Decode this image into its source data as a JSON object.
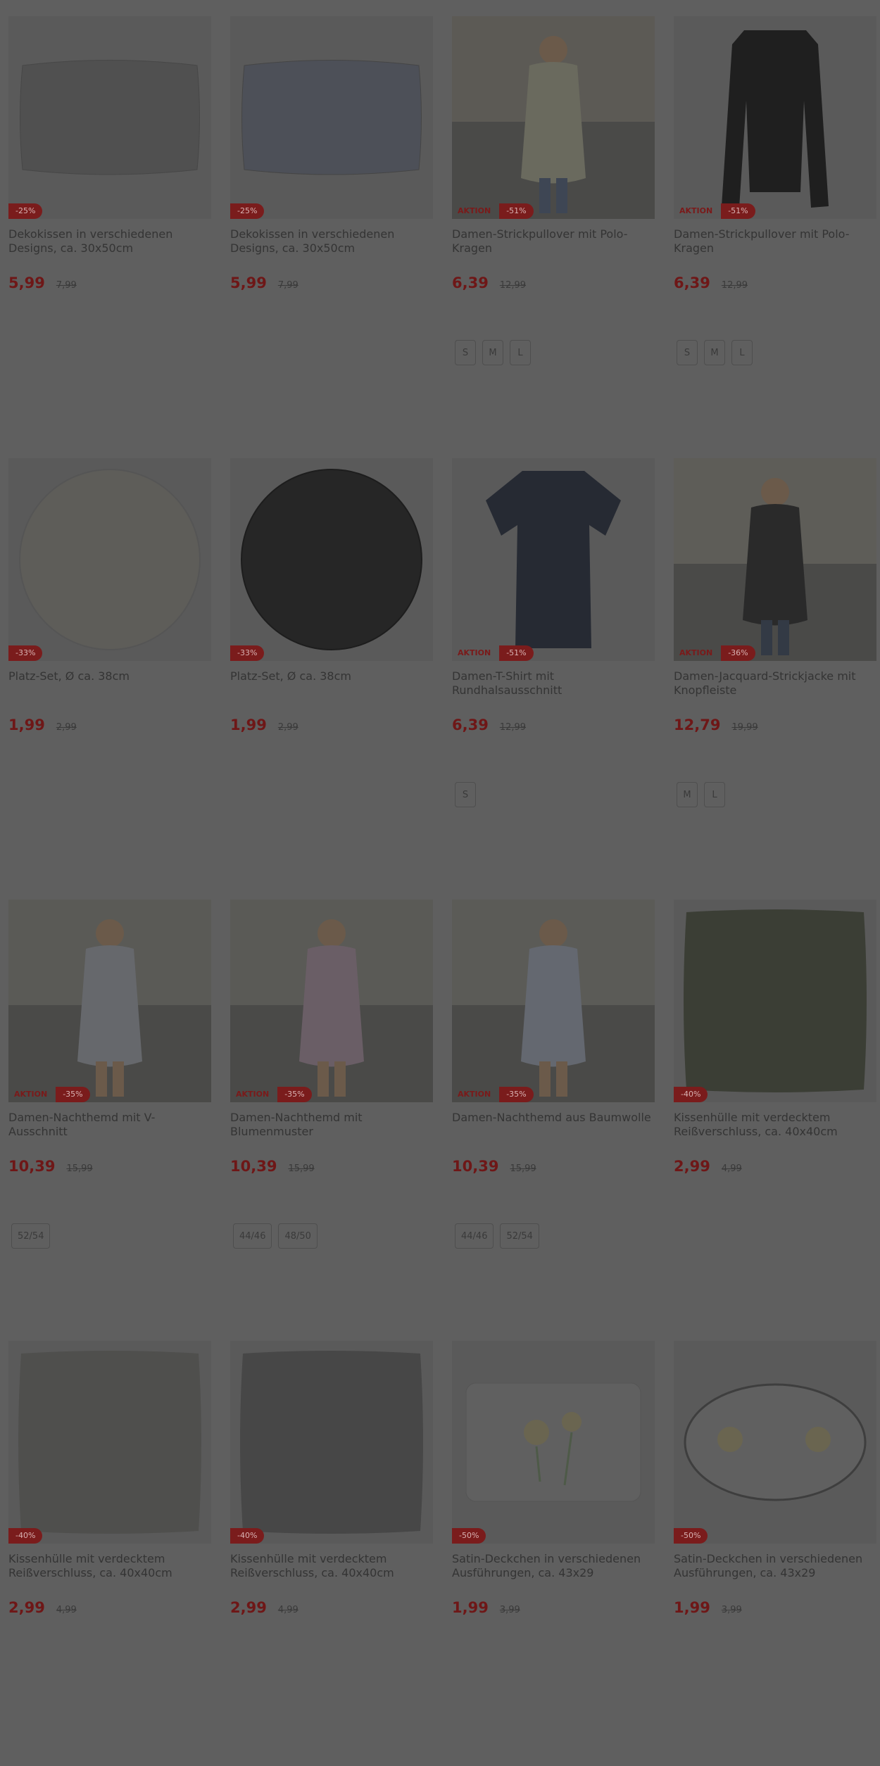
{
  "colors": {
    "overlay": "#5f5f5f",
    "price": "#6e1717",
    "badge": "#7a1c1c"
  },
  "products": [
    {
      "title": "Dekokissen in verschiedenen Designs, ca. 30x50cm",
      "price": "5,99",
      "old_price": "7,99",
      "discount": "-25%",
      "aktion": "",
      "sizes": [],
      "image": "pillow-rect"
    },
    {
      "title": "Dekokissen in verschiedenen Designs, ca. 30x50cm",
      "price": "5,99",
      "old_price": "7,99",
      "discount": "-25%",
      "aktion": "",
      "sizes": [],
      "image": "pillow-rect-floral"
    },
    {
      "title": "Damen-Strickpullover mit Polo-Kragen",
      "price": "6,39",
      "old_price": "12,99",
      "discount": "-51%",
      "aktion": "AKTION",
      "sizes": [
        "S",
        "M",
        "L"
      ],
      "image": "model-sweater"
    },
    {
      "title": "Damen-Strickpullover mit Polo-Kragen",
      "price": "6,39",
      "old_price": "12,99",
      "discount": "-51%",
      "aktion": "AKTION",
      "sizes": [
        "S",
        "M",
        "L"
      ],
      "image": "sweater-black"
    },
    {
      "title": "Platz-Set, Ø ca. 38cm",
      "price": "1,99",
      "old_price": "2,99",
      "discount": "-33%",
      "aktion": "",
      "sizes": [],
      "image": "placemat-light"
    },
    {
      "title": "Platz-Set, Ø ca. 38cm",
      "price": "1,99",
      "old_price": "2,99",
      "discount": "-33%",
      "aktion": "",
      "sizes": [],
      "image": "placemat-dark"
    },
    {
      "title": "Damen-T-Shirt mit Rundhalsausschnitt",
      "price": "6,39",
      "old_price": "12,99",
      "discount": "-51%",
      "aktion": "AKTION",
      "sizes": [
        "S"
      ],
      "image": "tshirt"
    },
    {
      "title": "Damen-Jacquard-Strickjacke mit Knopfleiste",
      "price": "12,79",
      "old_price": "19,99",
      "discount": "-36%",
      "aktion": "AKTION",
      "sizes": [
        "M",
        "L"
      ],
      "image": "model-cardigan"
    },
    {
      "title": "Damen-Nachthemd mit V-Ausschnitt",
      "price": "10,39",
      "old_price": "15,99",
      "discount": "-35%",
      "aktion": "AKTION",
      "sizes": [
        "52/54"
      ],
      "image": "model-nightgown"
    },
    {
      "title": "Damen-Nachthemd mit Blumenmuster",
      "price": "10,39",
      "old_price": "15,99",
      "discount": "-35%",
      "aktion": "AKTION",
      "sizes": [
        "44/46",
        "48/50"
      ],
      "image": "model-nightgown-floral"
    },
    {
      "title": "Damen-Nachthemd aus Baumwolle",
      "price": "10,39",
      "old_price": "15,99",
      "discount": "-35%",
      "aktion": "AKTION",
      "sizes": [
        "44/46",
        "52/54"
      ],
      "image": "model-nightgown-cotton"
    },
    {
      "title": "Kissenhülle mit verdecktem Reißverschluss, ca. 40x40cm",
      "price": "2,99",
      "old_price": "4,99",
      "discount": "-40%",
      "aktion": "",
      "sizes": [],
      "image": "pillow-green"
    },
    {
      "title": "Kissenhülle mit verdecktem Reißverschluss, ca. 40x40cm",
      "price": "2,99",
      "old_price": "4,99",
      "discount": "-40%",
      "aktion": "",
      "sizes": [],
      "image": "pillow-gray"
    },
    {
      "title": "Kissenhülle mit verdecktem Reißverschluss, ca. 40x40cm",
      "price": "2,99",
      "old_price": "4,99",
      "discount": "-40%",
      "aktion": "",
      "sizes": [],
      "image": "pillow-dark"
    },
    {
      "title": "Satin-Deckchen in verschiedenen Ausführungen, ca. 43x29",
      "price": "1,99",
      "old_price": "3,99",
      "discount": "-50%",
      "aktion": "",
      "sizes": [],
      "image": "doily-rect"
    },
    {
      "title": "Satin-Deckchen in verschiedenen Ausführungen, ca. 43x29",
      "price": "1,99",
      "old_price": "3,99",
      "discount": "-50%",
      "aktion": "",
      "sizes": [],
      "image": "doily-oval"
    }
  ]
}
